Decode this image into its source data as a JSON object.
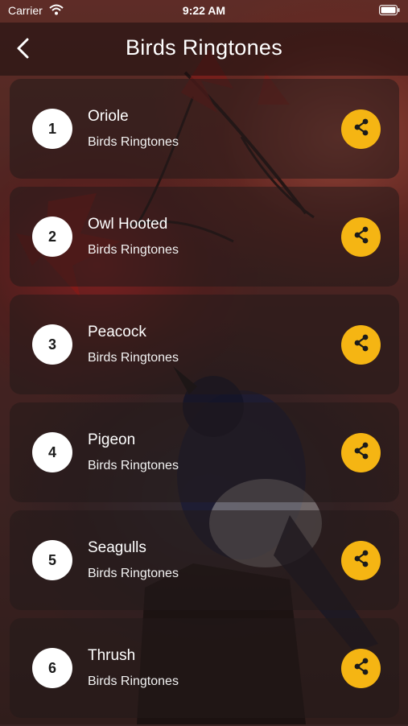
{
  "status_bar": {
    "carrier": "Carrier",
    "time": "9:22 AM"
  },
  "nav": {
    "title": "Birds Ringtones"
  },
  "colors": {
    "accent": "#f5b513",
    "number_circle": "#ffffff"
  },
  "ringtones": [
    {
      "number": "1",
      "name": "Oriole",
      "subtitle": "Birds Ringtones"
    },
    {
      "number": "2",
      "name": "Owl Hooted",
      "subtitle": "Birds Ringtones"
    },
    {
      "number": "3",
      "name": "Peacock",
      "subtitle": "Birds Ringtones"
    },
    {
      "number": "4",
      "name": "Pigeon",
      "subtitle": "Birds Ringtones"
    },
    {
      "number": "5",
      "name": "Seagulls",
      "subtitle": "Birds Ringtones"
    },
    {
      "number": "6",
      "name": "Thrush",
      "subtitle": "Birds Ringtones"
    }
  ]
}
